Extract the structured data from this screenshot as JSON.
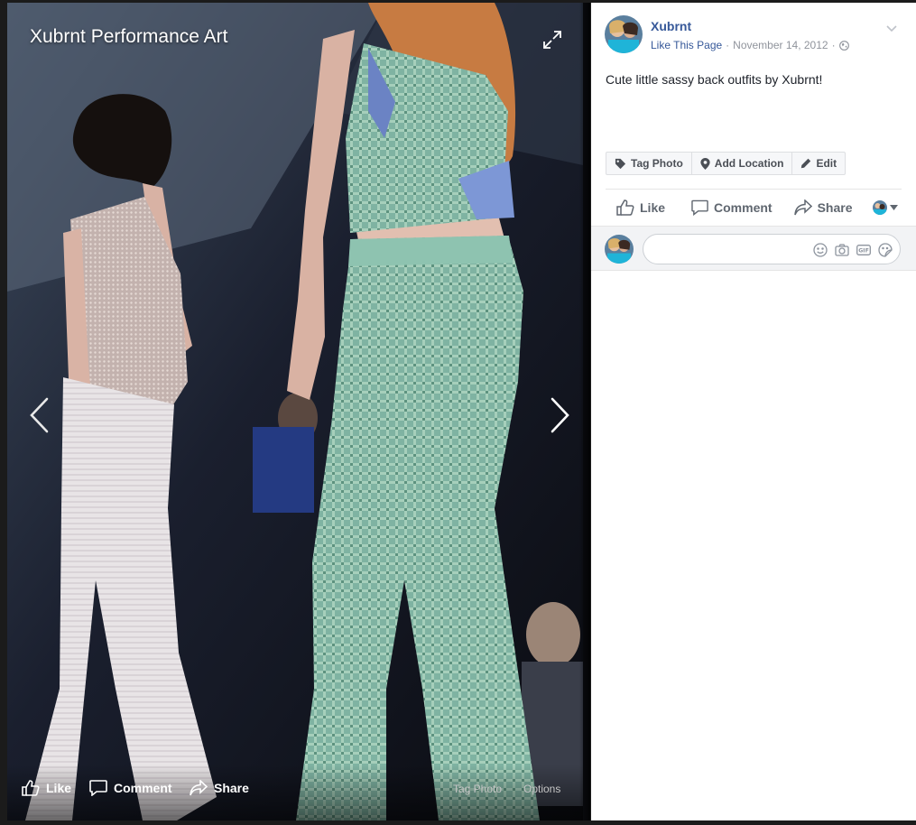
{
  "photo_viewer": {
    "album_title": "Xubrnt Performance Art",
    "photo_actions": {
      "like": "Like",
      "comment": "Comment",
      "share": "Share"
    },
    "tag_photo": "Tag Photo",
    "options": "Options"
  },
  "post": {
    "page_name": "Xubrnt",
    "like_page": "Like This Page",
    "separator": "·",
    "date": "November 14, 2012",
    "caption": "Cute little sassy back outfits by Xubrnt!",
    "tools": {
      "tag_photo": "Tag Photo",
      "add_location": "Add Location",
      "edit": "Edit"
    },
    "actions": {
      "like": "Like",
      "comment": "Comment",
      "share": "Share"
    },
    "comment_input_placeholder": ""
  },
  "colors": {
    "link_blue": "#365899",
    "meta_gray": "#90949c",
    "action_gray": "#606770"
  },
  "icons": [
    "expand-icon",
    "arrow-left-icon",
    "arrow-right-icon",
    "thumbs-up-icon",
    "comment-icon",
    "share-icon",
    "globe-icon",
    "chevron-down-icon",
    "tag-icon",
    "location-pin-icon",
    "pencil-icon",
    "emoji-icon",
    "camera-icon",
    "gif-icon",
    "sticker-icon"
  ]
}
